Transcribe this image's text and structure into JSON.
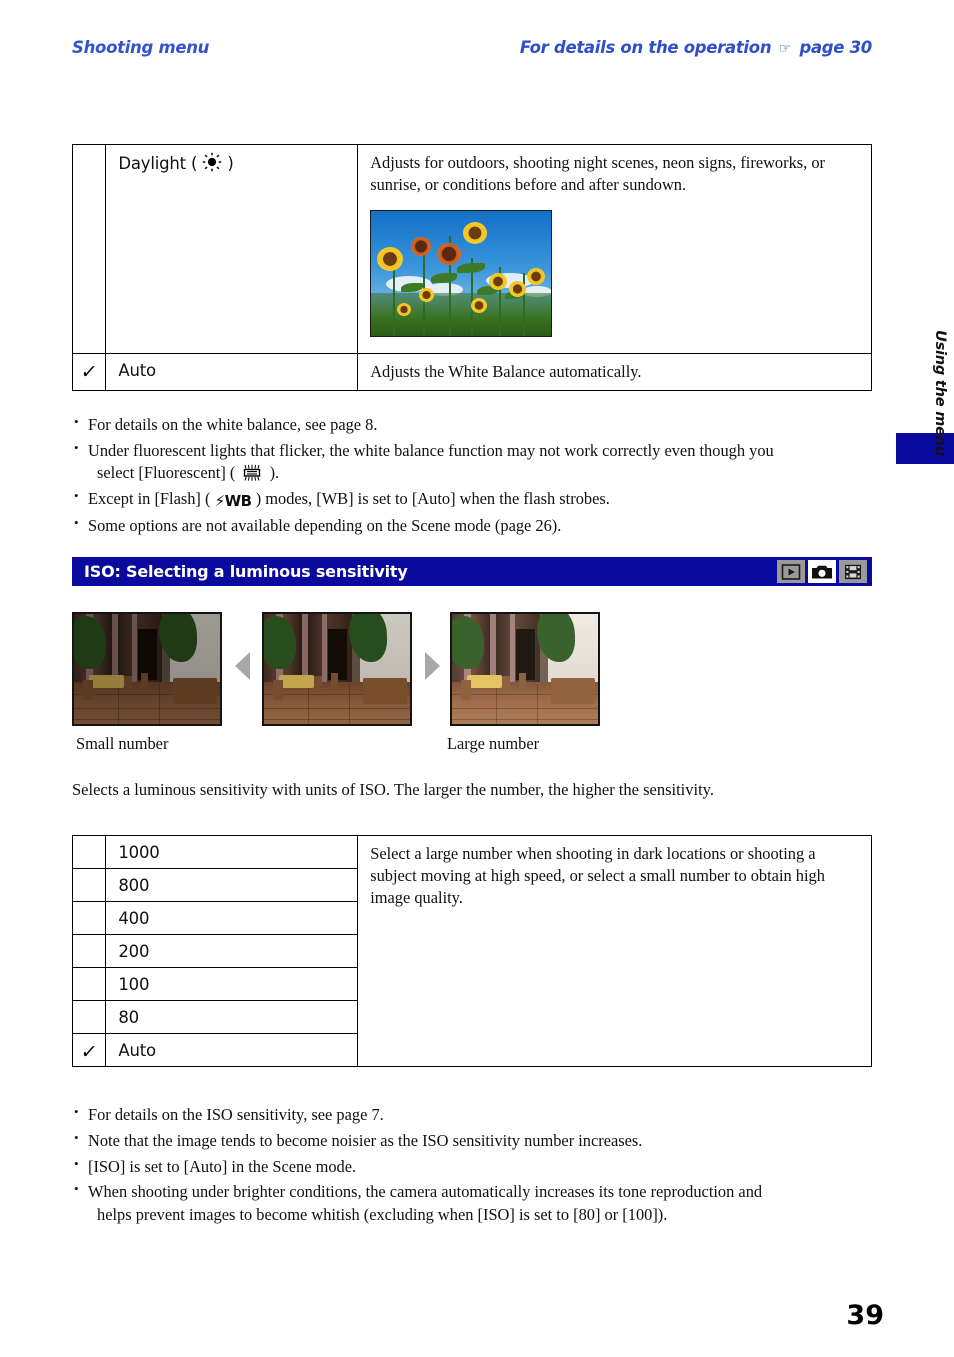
{
  "header": {
    "left": "Shooting menu",
    "right_prefix": "For details on the operation",
    "right_pointer": "☞",
    "right_suffix": "page 30"
  },
  "wb_table": {
    "rows": [
      {
        "check": "",
        "label": "Daylight (",
        "label_suffix": ")",
        "icon": "sun-icon",
        "desc": "Adjusts for outdoors, shooting night scenes, neon signs, fireworks, or sunrise, or conditions before and after sundown.",
        "photo": "sunflower-field-photo"
      },
      {
        "check": "✓",
        "label": "Auto",
        "label_suffix": "",
        "icon": "",
        "desc": "Adjusts the White Balance automatically.",
        "photo": ""
      }
    ]
  },
  "wb_notes": [
    {
      "text": "For details on the white balance, see page 8."
    },
    {
      "text": "Under fluorescent lights that flicker, the white balance function may not work correctly even though you",
      "cont_pre": "select [Fluorescent] (",
      "cont_icon": "fluorescent-icon",
      "cont_post": ")."
    },
    {
      "pre": "Except in [Flash] (",
      "icon": "flash-wb-icon",
      "icon_text": "⚡WB",
      "post": ") modes, [WB] is set to [Auto] when the flash strobes."
    },
    {
      "text": "Some options are not available depending on the Scene mode (page 26)."
    }
  ],
  "iso_section": {
    "title": "ISO: Selecting a luminous sensitivity",
    "mode_icons": [
      {
        "name": "playback-mode-icon",
        "glyph": "▶",
        "active": false
      },
      {
        "name": "still-camera-mode-icon",
        "glyph": "camera",
        "active": true
      },
      {
        "name": "movie-mode-icon",
        "glyph": "film",
        "active": false
      }
    ],
    "samples": {
      "caption_left": "Small number",
      "caption_right": "Large number",
      "shots": [
        {
          "name": "iso-sample-dark",
          "brightness": 0.62
        },
        {
          "name": "iso-sample-medium",
          "brightness": 0.82
        },
        {
          "name": "iso-sample-bright",
          "brightness": 1.0
        }
      ]
    },
    "intro": "Selects a luminous sensitivity with units of ISO. The larger the number, the higher the sensitivity.",
    "table": {
      "values": [
        {
          "check": "",
          "label": "1000"
        },
        {
          "check": "",
          "label": "800"
        },
        {
          "check": "",
          "label": "400"
        },
        {
          "check": "",
          "label": "200"
        },
        {
          "check": "",
          "label": "100"
        },
        {
          "check": "",
          "label": "80"
        },
        {
          "check": "✓",
          "label": "Auto"
        }
      ],
      "desc": "Select a large number when shooting in dark locations or shooting a subject moving at high speed, or select a small number to obtain high image quality."
    },
    "notes": [
      {
        "text": "For details on the ISO sensitivity, see page 7."
      },
      {
        "text": "Note that the image tends to become noisier as the ISO sensitivity number increases."
      },
      {
        "text": "[ISO] is set to [Auto] in the Scene mode."
      },
      {
        "text": "When shooting under brighter conditions, the camera automatically increases its tone reproduction and",
        "cont": "helps prevent images to become whitish (excluding when [ISO] is set to [80] or [100])."
      }
    ]
  },
  "side_tab": {
    "label": "Using the menu"
  },
  "folio": "39",
  "colors": {
    "header_blue": "#3355cc",
    "section_blue": "#0a0a9e",
    "text": "#111111"
  }
}
